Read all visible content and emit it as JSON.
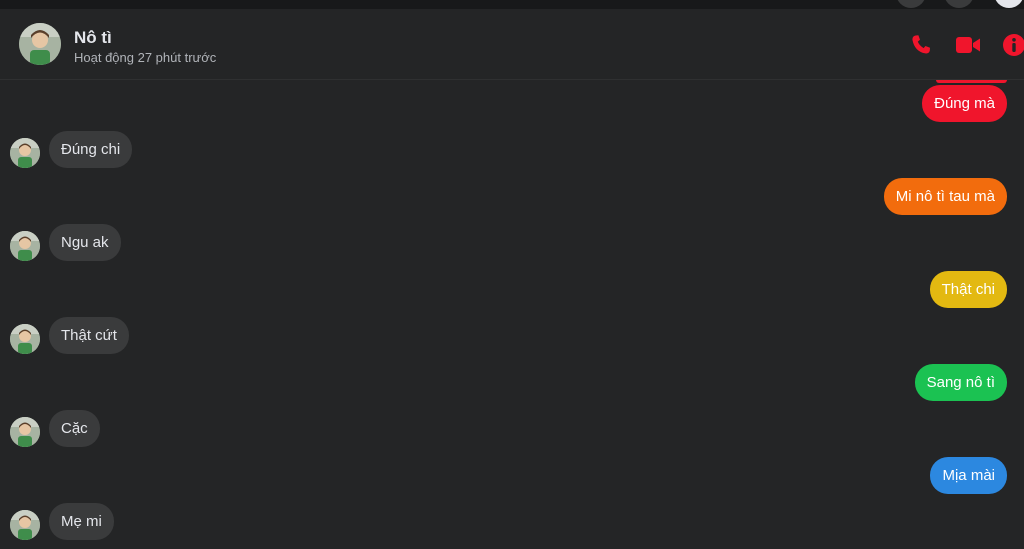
{
  "contact": {
    "name": "Nô tì",
    "status": "Hoạt động 27 phút trước"
  },
  "header_icons": [
    "phone-icon",
    "video-camera-icon",
    "info-icon"
  ],
  "accent_color": "#f0152c",
  "messages": [
    {
      "dir": "out",
      "text": "Đúng mà",
      "color": "#f0152c"
    },
    {
      "dir": "in",
      "text": "Đúng chi"
    },
    {
      "dir": "out",
      "text": "Mi nô tì tau mà",
      "color": "#f26c0d"
    },
    {
      "dir": "in",
      "text": "Ngu ak"
    },
    {
      "dir": "out",
      "text": "Thật chi",
      "color": "#e3b911"
    },
    {
      "dir": "in",
      "text": "Thật cứt"
    },
    {
      "dir": "out",
      "text": "Sang nô tì",
      "color": "#1bc252"
    },
    {
      "dir": "in",
      "text": "Cặc"
    },
    {
      "dir": "out",
      "text": "Mịa mài",
      "color": "#2c88e0"
    },
    {
      "dir": "in",
      "text": "Mẹ mi"
    }
  ]
}
